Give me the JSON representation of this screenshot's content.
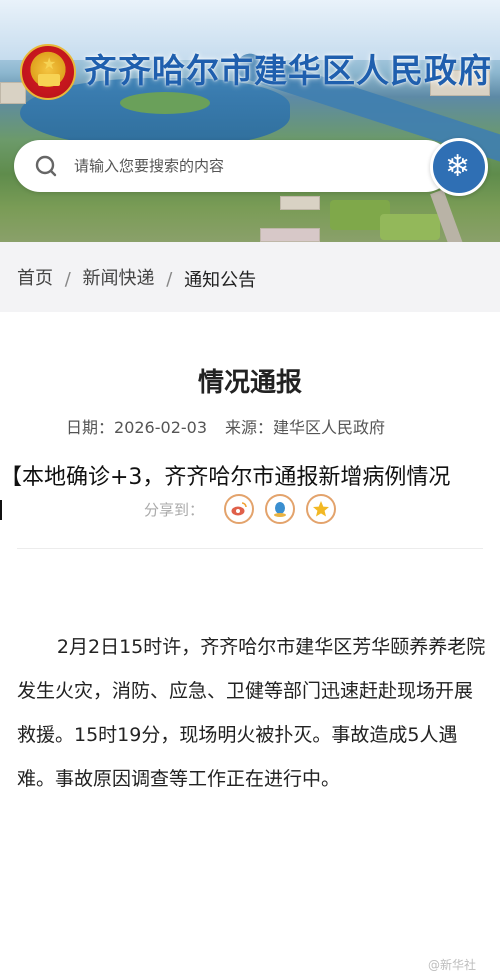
{
  "header": {
    "site_title": "齐齐哈尔市建华区人民政府",
    "search_placeholder": "请输入您要搜索的内容",
    "icons": {
      "emblem": "national-emblem-icon",
      "search": "search-icon",
      "badge": "snowflake-logo-icon"
    }
  },
  "breadcrumb": {
    "items": [
      "首页",
      "新闻快递",
      "通知公告"
    ],
    "separator": "/"
  },
  "article": {
    "title": "情况通报",
    "date_label": "日期：",
    "date": "2026-02-03",
    "source_label": "来源：",
    "source": "建华区人民政府",
    "share_label": "分享到：",
    "share_icons": [
      "weibo-icon",
      "qq-icon",
      "qzone-star-icon"
    ],
    "body": "2月2日15时许，齐齐哈尔市建华区芳华颐养养老院发生火灾，消防、应急、卫健等部门迅速赶赴现场开展救援。15时19分，现场明火被扑灭。事故造成5人遇难。事故原因调查等工作正在进行中。"
  },
  "overlay": {
    "headline": "【本地确诊+3，齐齐哈尔市通报新增病例情况"
  },
  "watermark": {
    "text": "@新华社"
  },
  "colors": {
    "title_blue": "#1f5fae",
    "breadcrumb_bg": "#f3f3f5",
    "share_ring": "#e3a36c",
    "badge_blue": "#2f6fb4"
  }
}
